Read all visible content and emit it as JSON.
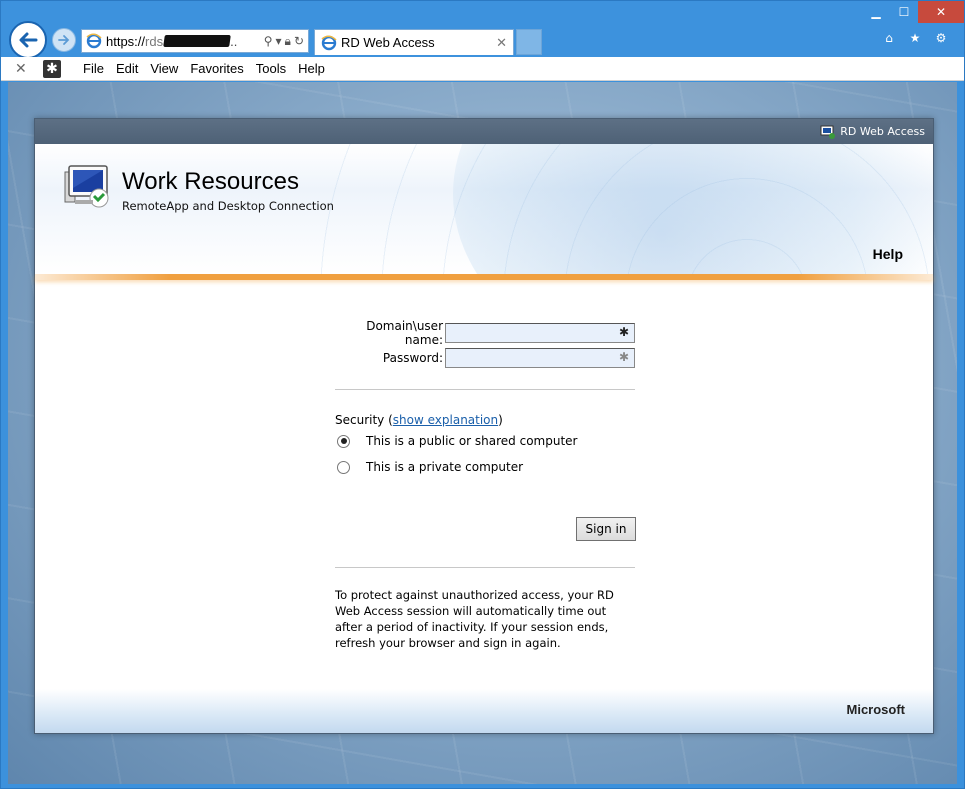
{
  "browser": {
    "url_prefix": "https://",
    "url_gray": "rds",
    "url_suffix": "..",
    "tab_title": "RD Web Access",
    "menu": [
      "File",
      "Edit",
      "View",
      "Favorites",
      "Tools",
      "Help"
    ]
  },
  "page": {
    "top_label": "RD Web Access",
    "title": "Work Resources",
    "subtitle": "RemoteApp and Desktop Connection",
    "help": "Help",
    "form": {
      "username_label": "Domain\\user name:",
      "password_label": "Password:",
      "username_value": "",
      "password_value": "",
      "security_prefix": "Security (",
      "security_link": "show explanation",
      "security_suffix": ")",
      "radio_public": "This is a public or shared computer",
      "radio_private": "This is a private computer",
      "selected": "public",
      "signin": "Sign in",
      "notice": "To protect against unauthorized access, your RD Web Access session will automatically time out after a period of inactivity. If your session ends, refresh your browser and sign in again."
    },
    "footer_brand": "Microsoft"
  },
  "colors": {
    "accent_orange": "#f0a040",
    "chrome_blue": "#3d92dd",
    "link": "#1a5faa"
  }
}
